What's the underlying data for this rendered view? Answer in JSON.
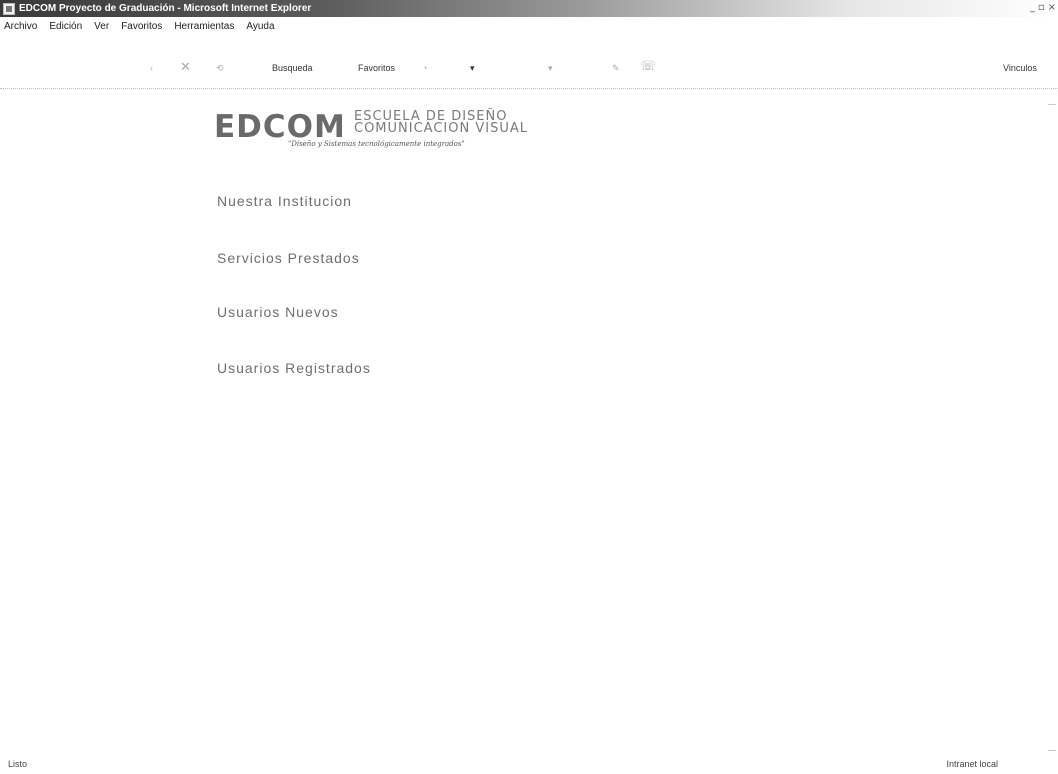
{
  "window": {
    "title": "EDCOM Proyecto de Graduación - Microsoft Internet Explorer",
    "controls": [
      "_",
      "▫",
      "×"
    ]
  },
  "menu": [
    "Archivo",
    "Edición",
    "Ver",
    "Favoritos",
    "Herramientas",
    "Ayuda"
  ],
  "toolbar": {
    "search_label": "Busqueda",
    "favorites_label": "Favoritos",
    "links_label": "Vinculos",
    "icons": [
      "back-icon",
      "forward-icon",
      "stop-icon",
      "refresh-icon",
      "home-icon",
      "history-icon",
      "mail-icon",
      "print-icon",
      "edit-icon"
    ]
  },
  "logo": {
    "wordmark": "EDCOM",
    "line1": "ESCUELA DE DISEÑO",
    "line2": "COMUNICACION VISUAL",
    "tagline": "\"Diseño y Sistemas tecnológicamente integrados\""
  },
  "nav": [
    {
      "label": "Nuestra Institucion"
    },
    {
      "label": "Servicios Prestados"
    },
    {
      "label": "Usuarios Nuevos"
    },
    {
      "label": "Usuarios Registrados"
    }
  ],
  "status": {
    "left": "Listo",
    "right": "Intranet local"
  }
}
